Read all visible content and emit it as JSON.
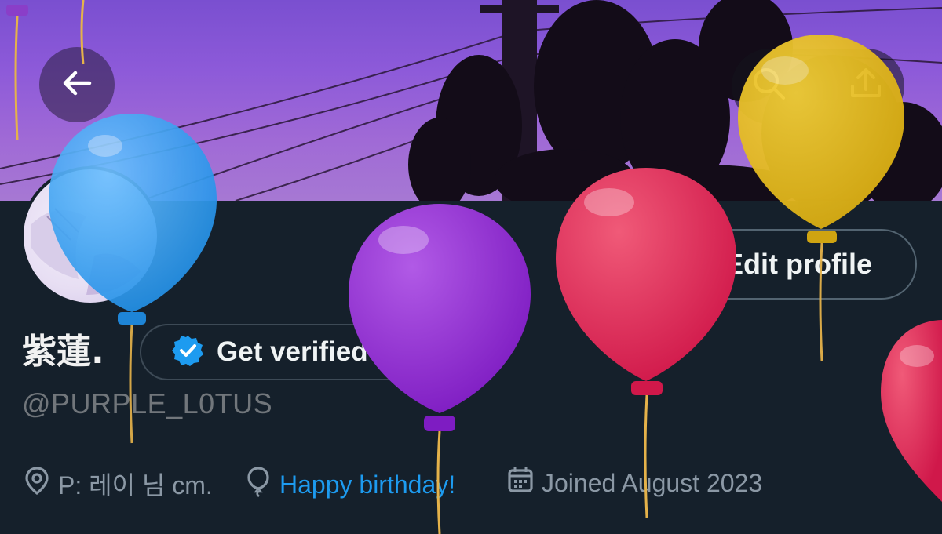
{
  "header": {
    "back_icon": "arrow-left-icon",
    "search_icon": "search-icon",
    "share_icon": "share-icon"
  },
  "profile": {
    "display_name": "紫蓮.",
    "handle": "@PURPLE_L0TUS",
    "edit_profile_label": "Edit profile",
    "get_verified_label": "Get verified",
    "verified_badge_color": "#1d9bf0"
  },
  "meta": {
    "location": "P: 레이 님 cm.",
    "birthday": "Happy birthday!",
    "joined": "Joined August 2023"
  },
  "colors": {
    "background": "#15202b",
    "link": "#1d9bf0",
    "muted": "#71767b",
    "banner_sky": "#8d5ad9"
  },
  "decorations": [
    "blue-balloon",
    "purple-balloon",
    "red-balloon",
    "yellow-balloon",
    "red-balloon-edge"
  ]
}
